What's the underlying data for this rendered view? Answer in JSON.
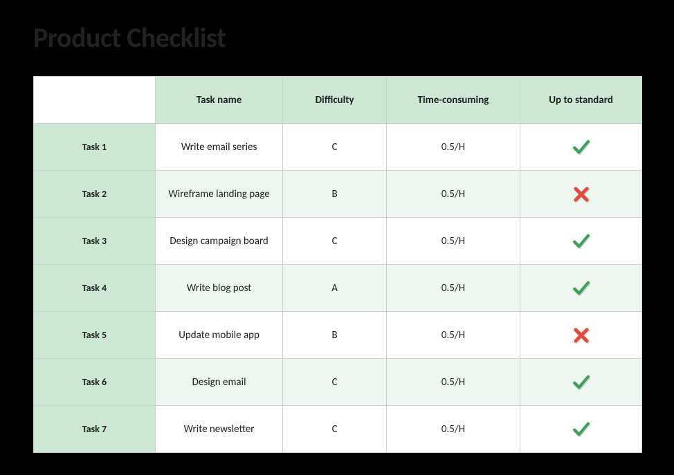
{
  "title": "Product Checklist",
  "columns": {
    "row_label": "",
    "task_name": "Task name",
    "difficulty": "Difficulty",
    "time": "Time-consuming",
    "standard": "Up to standard"
  },
  "rows": [
    {
      "row_label": "Task 1",
      "task_name": "Write email series",
      "difficulty": "C",
      "time": "0.5/H",
      "standard": true
    },
    {
      "row_label": "Task 2",
      "task_name": "Wireframe landing page",
      "difficulty": "B",
      "time": "0.5/H",
      "standard": false
    },
    {
      "row_label": "Task 3",
      "task_name": "Design campaign board",
      "difficulty": "C",
      "time": "0.5/H",
      "standard": true
    },
    {
      "row_label": "Task 4",
      "task_name": "Write blog post",
      "difficulty": "A",
      "time": "0.5/H",
      "standard": true
    },
    {
      "row_label": "Task 5",
      "task_name": "Update mobile app",
      "difficulty": "B",
      "time": "0.5/H",
      "standard": false
    },
    {
      "row_label": "Task 6",
      "task_name": "Design email",
      "difficulty": "C",
      "time": "0.5/H",
      "standard": true
    },
    {
      "row_label": "Task 7",
      "task_name": "Write newsletter",
      "difficulty": "C",
      "time": "0.5/H",
      "standard": true
    }
  ],
  "colors": {
    "header_bg": "#cce8d4",
    "alt_bg": "#edf7f0",
    "check": "#3fa05a",
    "cross": "#e24a3b"
  },
  "chart_data": {
    "type": "table",
    "title": "Product Checklist",
    "columns": [
      "Task name",
      "Difficulty",
      "Time-consuming",
      "Up to standard"
    ],
    "rows": [
      [
        "Write email series",
        "C",
        "0.5/H",
        "yes"
      ],
      [
        "Wireframe landing page",
        "B",
        "0.5/H",
        "no"
      ],
      [
        "Design campaign board",
        "C",
        "0.5/H",
        "yes"
      ],
      [
        "Write blog post",
        "A",
        "0.5/H",
        "yes"
      ],
      [
        "Update mobile app",
        "B",
        "0.5/H",
        "no"
      ],
      [
        "Design email",
        "C",
        "0.5/H",
        "yes"
      ],
      [
        "Write newsletter",
        "C",
        "0.5/H",
        "yes"
      ]
    ]
  }
}
